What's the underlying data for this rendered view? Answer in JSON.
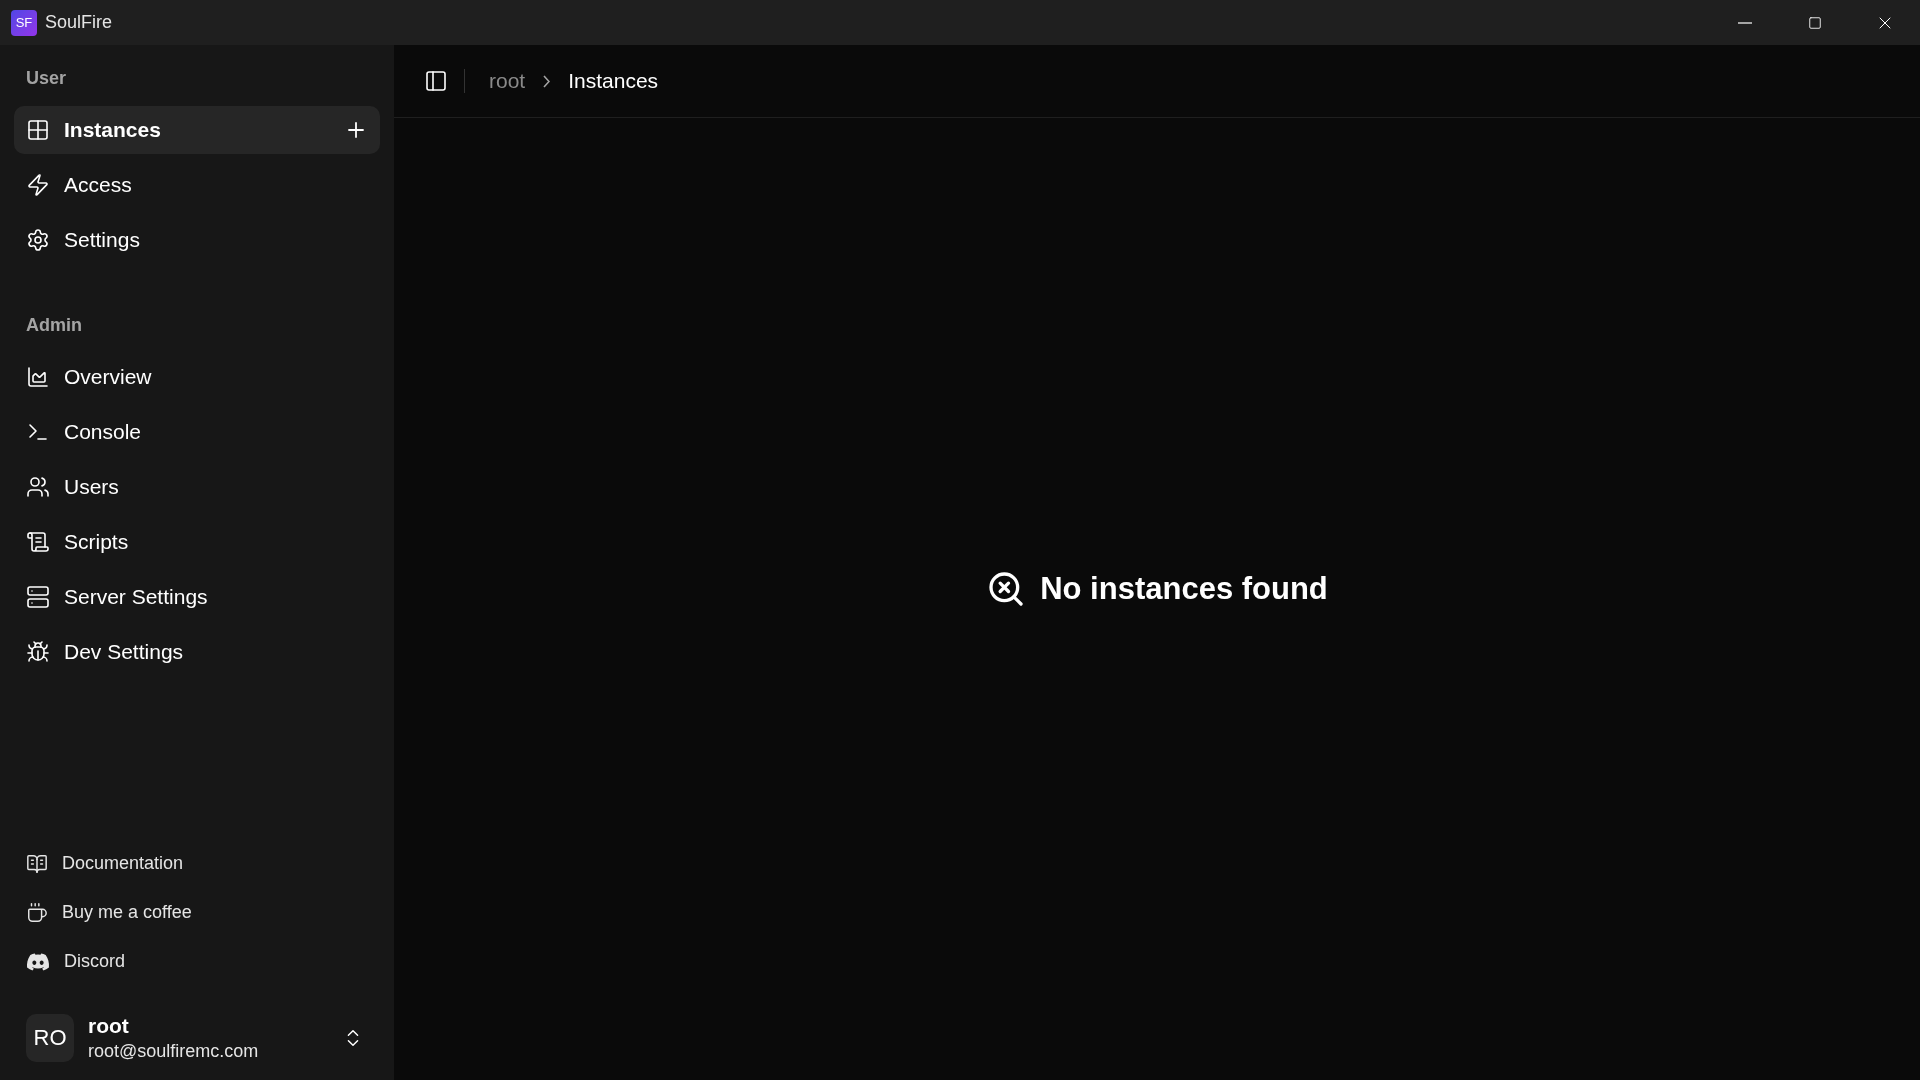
{
  "window": {
    "logo": "SF",
    "title": "SoulFire"
  },
  "sidebar": {
    "sections": [
      {
        "label": "User",
        "items": [
          {
            "label": "Instances",
            "selected": true,
            "add_button": true
          },
          {
            "label": "Access",
            "selected": false,
            "add_button": false
          },
          {
            "label": "Settings",
            "selected": false,
            "add_button": false
          }
        ]
      },
      {
        "label": "Admin",
        "items": [
          {
            "label": "Overview",
            "selected": false,
            "add_button": false
          },
          {
            "label": "Console",
            "selected": false,
            "add_button": false
          },
          {
            "label": "Users",
            "selected": false,
            "add_button": false
          },
          {
            "label": "Scripts",
            "selected": false,
            "add_button": false
          },
          {
            "label": "Server Settings",
            "selected": false,
            "add_button": false
          },
          {
            "label": "Dev Settings",
            "selected": false,
            "add_button": false
          }
        ]
      }
    ],
    "links": [
      "Documentation",
      "Buy me a coffee",
      "Discord"
    ],
    "user": {
      "initials": "RO",
      "name": "root",
      "email": "root@soulfiremc.com"
    }
  },
  "breadcrumb": [
    {
      "label": "root",
      "current": false
    },
    {
      "label": "Instances",
      "current": true
    }
  ],
  "empty_state": "No instances found"
}
